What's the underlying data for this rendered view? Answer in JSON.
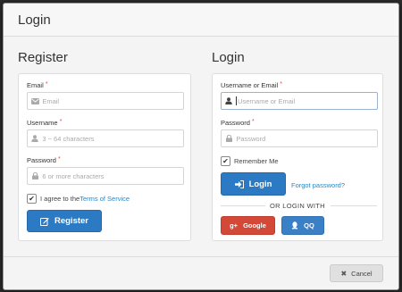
{
  "modal": {
    "title": "Login"
  },
  "register": {
    "heading": "Register",
    "email_label": "Email",
    "email_placeholder": "Email",
    "username_label": "Username",
    "username_placeholder": "3 ~ 64 characters",
    "password_label": "Password",
    "password_placeholder": "6 or more characters",
    "terms_text": "I agree to the",
    "terms_link": "Terms of Service",
    "button_label": "Register"
  },
  "login": {
    "heading": "Login",
    "username_label": "Username or Email",
    "username_placeholder": "Username or Email",
    "password_label": "Password",
    "password_placeholder": "Password",
    "remember_label": "Remember Me",
    "button_label": "Login",
    "forgot_link": "Forgot password?",
    "or_login_with": "OR LOGIN WITH",
    "google_label": "Google",
    "qq_label": "QQ"
  },
  "required_mark": "*",
  "footer": {
    "cancel_label": "Cancel"
  },
  "colors": {
    "primary": "#2d7ac4",
    "google": "#d34836",
    "qq": "#3a80c6",
    "link": "#2a88c5",
    "required": "#d9534f"
  },
  "icons": [
    "envelope-icon",
    "user-icon",
    "lock-icon",
    "check-icon",
    "edit-icon",
    "sign-in-icon",
    "google-plus-icon",
    "qq-icon",
    "close-icon"
  ]
}
